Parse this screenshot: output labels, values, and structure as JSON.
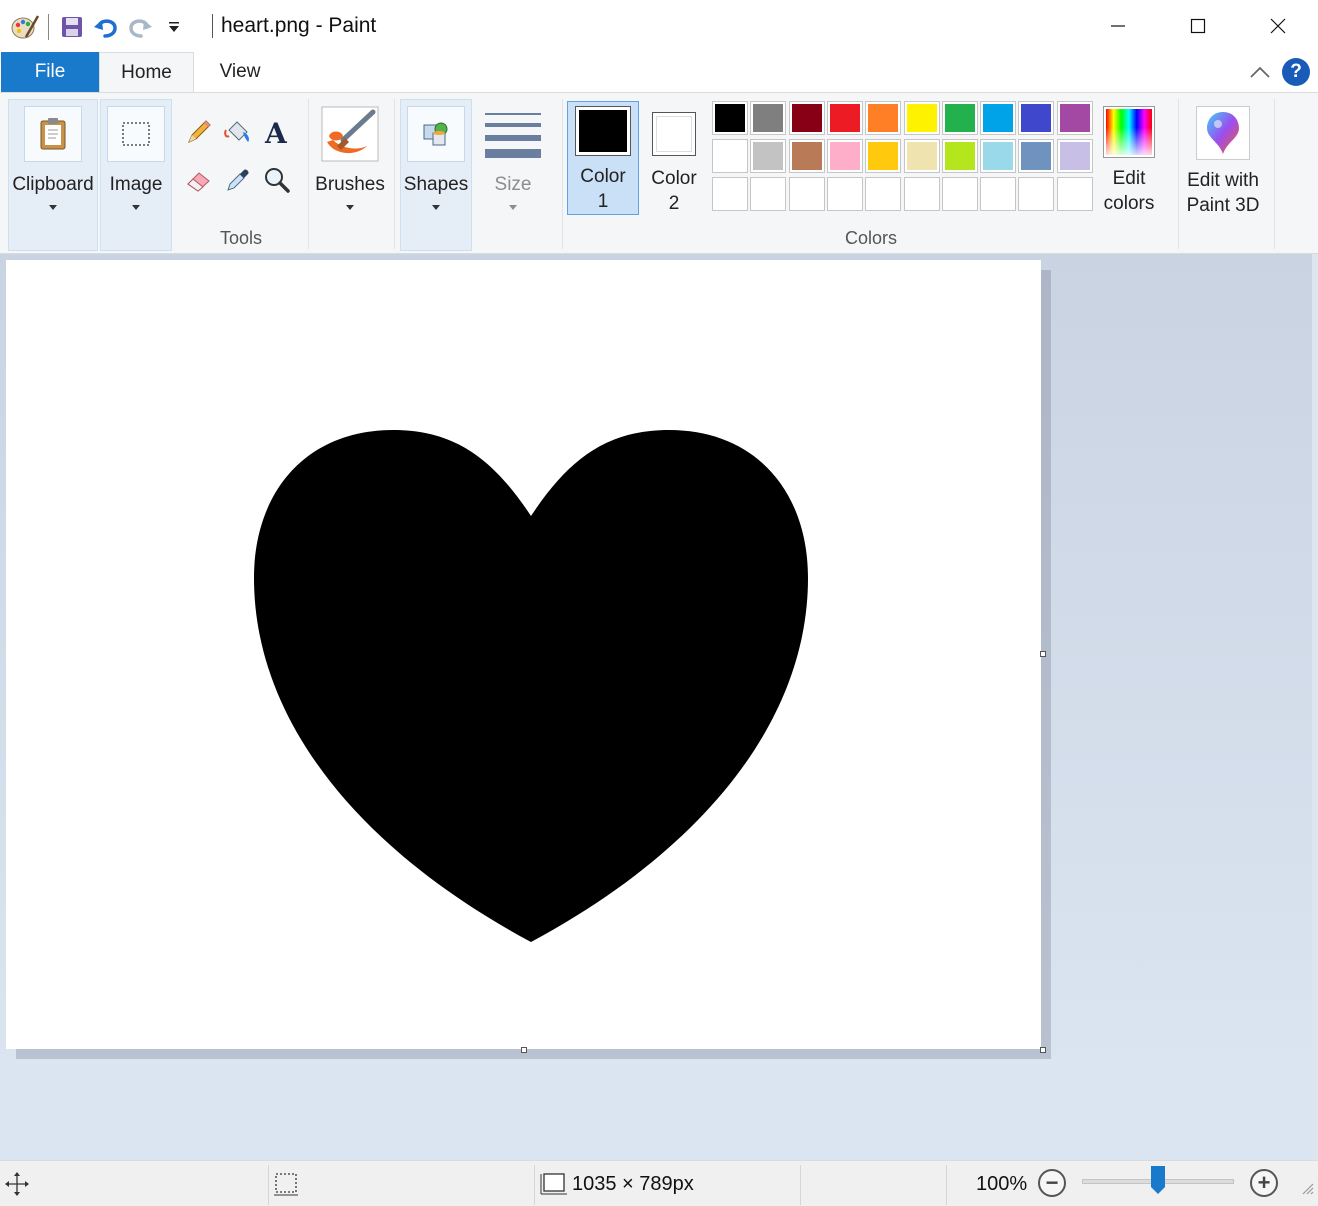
{
  "window": {
    "title": "heart.png - Paint"
  },
  "tabs": {
    "file": "File",
    "home": "Home",
    "view": "View"
  },
  "ribbon": {
    "clipboard": "Clipboard",
    "image": "Image",
    "tools_group": "Tools",
    "brushes": "Brushes",
    "shapes": "Shapes",
    "size": "Size",
    "color1_line1": "Color",
    "color1_line2": "1",
    "color2_line1": "Color",
    "color2_line2": "2",
    "colors_group": "Colors",
    "edit_colors_line1": "Edit",
    "edit_colors_line2": "colors",
    "edit3d_line1": "Edit with",
    "edit3d_line2": "Paint 3D",
    "help": "?"
  },
  "colors": {
    "color1": "#000000",
    "color2": "#ffffff",
    "palette_row1": [
      "#000000",
      "#7f7f7f",
      "#880015",
      "#ed1c24",
      "#ff7f27",
      "#fff200",
      "#22b14c",
      "#00a2e8",
      "#3f48cc",
      "#a349a4"
    ],
    "palette_row2": [
      "#ffffff",
      "#c3c3c3",
      "#b97a57",
      "#ffaec9",
      "#ffc90e",
      "#efe4b0",
      "#b5e61d",
      "#99d9ea",
      "#7092be",
      "#c8bfe7"
    ],
    "palette_row3": [
      "",
      "",
      "",
      "",
      "",
      "",
      "",
      "",
      "",
      ""
    ]
  },
  "statusbar": {
    "dimensions": "1035 × 789px",
    "zoom": "100%",
    "zoom_out": "−",
    "zoom_in": "+"
  }
}
